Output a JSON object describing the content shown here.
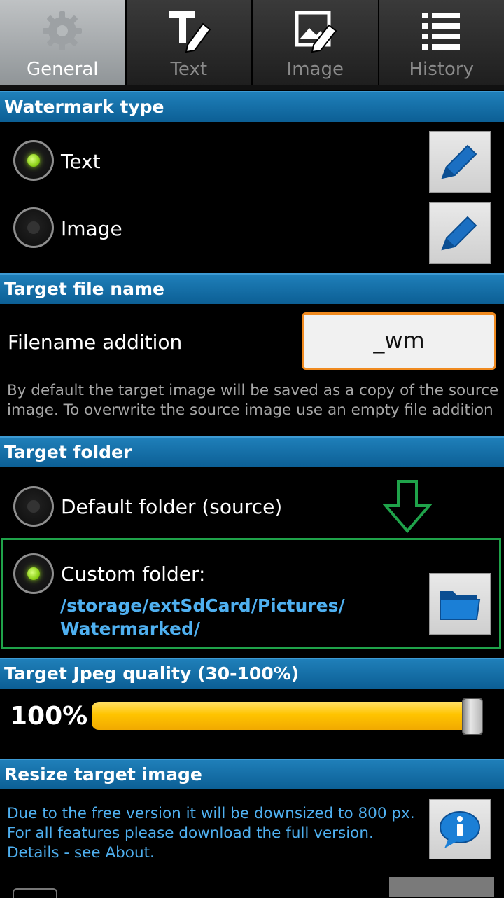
{
  "tabs": [
    {
      "label": "General",
      "icon": "gear-icon",
      "active": true
    },
    {
      "label": "Text",
      "icon": "text-pen-icon",
      "active": false
    },
    {
      "label": "Image",
      "icon": "image-pen-icon",
      "active": false
    },
    {
      "label": "History",
      "icon": "list-icon",
      "active": false
    }
  ],
  "watermark_type": {
    "header": "Watermark type",
    "options": [
      {
        "label": "Text",
        "checked": true
      },
      {
        "label": "Image",
        "checked": false
      }
    ]
  },
  "target_file_name": {
    "header": "Target file name",
    "label": "Filename addition",
    "value": "_wm",
    "description": "By default the target image will be saved as a copy of the source image. To overwrite the source image use an empty file addition"
  },
  "target_folder": {
    "header": "Target folder",
    "default_label": "Default folder (source)",
    "custom_label": "Custom folder:",
    "custom_path_line1": "/storage/extSdCard/Pictures/",
    "custom_path_line2": "Watermarked/",
    "selected": "custom"
  },
  "jpeg_quality": {
    "header": "Target Jpeg quality (30-100%)",
    "value_text": "100%",
    "value": 100,
    "min": 30,
    "max": 100
  },
  "resize": {
    "header": "Resize target image",
    "line1": "Due to the free version it will be downsized to 800 px.",
    "line2": "For all features please download the full version.",
    "line3": "Details - see About."
  },
  "colors": {
    "header_blue": "#0c5f95",
    "accent_orange": "#f08a1f",
    "link_blue": "#4fb0f0",
    "highlight_green": "#1fa34a",
    "slider_yellow": "#ffc400"
  }
}
